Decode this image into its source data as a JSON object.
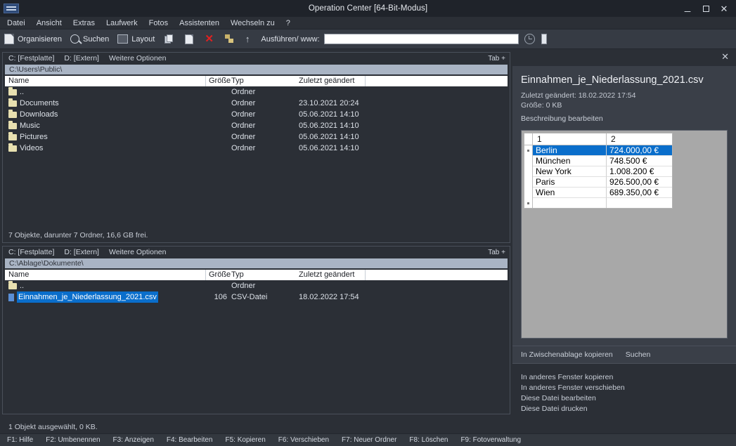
{
  "window": {
    "title": "Operation Center [64-Bit-Modus]",
    "minimize_label": "_",
    "maximize_label": "□",
    "close_label": "✕"
  },
  "menubar": {
    "items": [
      {
        "label": "Datei"
      },
      {
        "label": "Ansicht"
      },
      {
        "label": "Extras"
      },
      {
        "label": "Laufwerk"
      },
      {
        "label": "Fotos"
      },
      {
        "label": "Assistenten"
      },
      {
        "label": "Wechseln zu"
      },
      {
        "label": "?"
      }
    ]
  },
  "toolbar": {
    "organize_label": "Organisieren",
    "search_label": "Suchen",
    "layout_label": "Layout",
    "run_label": "Ausführen/ www:",
    "run_value": "",
    "run_placeholder": "",
    "icons": {
      "organize": "page-icon",
      "search": "search-icon",
      "layout": "layout-icon",
      "copy": "copy-icon",
      "paste": "paste-icon",
      "delete": "delete-x-icon",
      "tree": "folder-tree-icon",
      "up": "arrow-up-icon",
      "history": "clock-icon",
      "panel": "panel-toggle-icon"
    }
  },
  "panel_top": {
    "tabs": [
      "C: [Festplatte]",
      "D: [Extern]",
      "Weitere Optionen"
    ],
    "tab_plus": "Tab +",
    "path": "C:\\Users\\Public\\",
    "columns": [
      "Name",
      "Größe",
      "Typ",
      "Zuletzt geändert"
    ],
    "rows": [
      {
        "icon": "folder-icon",
        "name": "..",
        "size": "",
        "type": "Ordner",
        "date": ""
      },
      {
        "icon": "folder-icon",
        "name": "Documents",
        "size": "",
        "type": "Ordner",
        "date": "23.10.2021 20:24"
      },
      {
        "icon": "folder-icon",
        "name": "Downloads",
        "size": "",
        "type": "Ordner",
        "date": "05.06.2021 14:10"
      },
      {
        "icon": "folder-icon",
        "name": "Music",
        "size": "",
        "type": "Ordner",
        "date": "05.06.2021 14:10"
      },
      {
        "icon": "folder-icon",
        "name": "Pictures",
        "size": "",
        "type": "Ordner",
        "date": "05.06.2021 14:10"
      },
      {
        "icon": "folder-icon",
        "name": "Videos",
        "size": "",
        "type": "Ordner",
        "date": "05.06.2021 14:10"
      }
    ],
    "status": "7 Objekte, darunter 7 Ordner, 16,6 GB frei."
  },
  "panel_bottom": {
    "tabs": [
      "C: [Festplatte]",
      "D: [Extern]",
      "Weitere Optionen"
    ],
    "tab_plus": "Tab +",
    "path": "C:\\Ablage\\Dokumente\\",
    "columns": [
      "Name",
      "Größe",
      "Typ",
      "Zuletzt geändert"
    ],
    "rows": [
      {
        "icon": "folder-icon",
        "name": "..",
        "size": "",
        "type": "Ordner",
        "date": "",
        "selected": false
      },
      {
        "icon": "file-icon",
        "name": "Einnahmen_je_Niederlassung_2021.csv",
        "size": "106",
        "type": "CSV-Datei",
        "date": "18.02.2022 17:54",
        "selected": true
      }
    ],
    "status": "1 Objekt ausgewählt, 0 KB."
  },
  "preview": {
    "close_label": "✕",
    "title": "Einnahmen_je_Niederlassung_2021.csv",
    "modified_label": "Zuletzt geändert: 18.02.2022 17:54",
    "size_label": "Größe: 0 KB",
    "edit_description_label": "Beschreibung bearbeiten",
    "actions": [
      "In Zwischenablage kopieren",
      "Suchen"
    ],
    "links": [
      "In anderes Fenster kopieren",
      "In anderes Fenster verschieben",
      "Diese Datei bearbeiten",
      "Diese Datei drucken"
    ]
  },
  "spreadsheet": {
    "headers": [
      "1",
      "2"
    ],
    "rows": [
      {
        "c1": "Berlin",
        "c2": "724.000,00 €",
        "selected": true
      },
      {
        "c1": "München",
        "c2": "748.500 €",
        "selected": false
      },
      {
        "c1": "New York",
        "c2": "1.008.200 €",
        "selected": false
      },
      {
        "c1": "Paris",
        "c2": "926.500,00 €",
        "selected": false
      },
      {
        "c1": "Wien",
        "c2": "689.350,00 €",
        "selected": false
      }
    ]
  },
  "function_keys": [
    "F1: Hilfe",
    "F2: Umbenennen",
    "F3: Anzeigen",
    "F4: Bearbeiten",
    "F5: Kopieren",
    "F6: Verschieben",
    "F7: Neuer Ordner",
    "F8: Löschen",
    "F9: Fotoverwaltung"
  ],
  "colors": {
    "window_bg": "#2b2f36",
    "titlebar": "#1f232a",
    "toolbar": "#363b44",
    "accent_selection": "#0a6ecb",
    "pathbar": "#a9b4c4",
    "delete_red": "#e02020",
    "folder_yellow": "#e8e0b0"
  }
}
